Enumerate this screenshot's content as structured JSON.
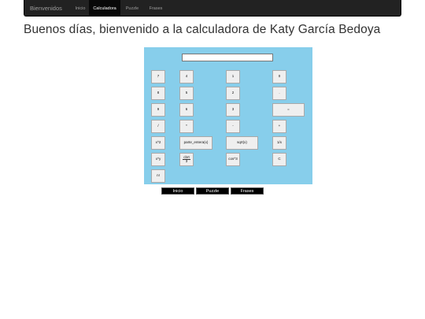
{
  "nav": {
    "brand": "Bienvenidos",
    "items": [
      {
        "label": "Inicio"
      },
      {
        "label": "Calculadora"
      },
      {
        "label": "Puzzle"
      },
      {
        "label": "Frases"
      }
    ]
  },
  "title": "Buenos días, bienvenido a la calculadora de Katy García Bedoya",
  "calculator": {
    "display_value": "",
    "keys": {
      "k7": "7",
      "k4": "4",
      "k1": "1",
      "k0": "0",
      "k8": "8",
      "k5": "5",
      "k2": "2",
      "dot": ".",
      "k9": "9",
      "k6": "6",
      "k3": "3",
      "equals": "=",
      "divide": "/",
      "multiply": "*",
      "minus": "-",
      "plus": "+",
      "square": "x^2",
      "integer_part": "parte_entera(x)",
      "sqrt": "sqrt(x)",
      "reciprocal": "1/x",
      "power": "x^y",
      "cuberoot_top": "cbrt",
      "cuberoot_bottom": "3",
      "cube_power": "cos^3",
      "clear": "C",
      "factorial": "n!"
    }
  },
  "bottom_buttons": {
    "inicio": "Inicio",
    "puzzle": "Puzzle",
    "frases": "Frases"
  }
}
